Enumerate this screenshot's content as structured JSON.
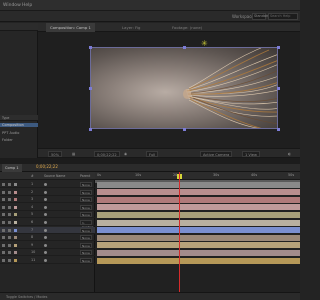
{
  "menubar": {
    "items": [
      "Window",
      "Help"
    ]
  },
  "workspace": {
    "label": "Workspace:",
    "value": "Standard",
    "search_placeholder": "Search Help"
  },
  "project": {
    "items": [
      {
        "label": "Composition",
        "selected": true
      },
      {
        "label": "PPT Audio",
        "selected": false
      },
      {
        "label": "Folder",
        "selected": false
      }
    ],
    "header": "Type"
  },
  "composition_tabs": [
    {
      "label": "Composition: Comp 1",
      "active": true
    },
    {
      "label": "Layer: Fig",
      "active": false
    },
    {
      "label": "Footage: (none)",
      "active": false
    }
  ],
  "viewer_controls": {
    "zoom": "50%",
    "timecode": "0;00;22;22",
    "resolution": "Full",
    "camera": "Active Camera",
    "views": "1 View"
  },
  "timeline": {
    "tab_label": "Comp 1",
    "timecode": "0;00;22;22",
    "columns": [
      "#",
      "Source Name",
      "Parent"
    ],
    "ruler_ticks": [
      "0s",
      "10s",
      "20s",
      "30s",
      "40s",
      "50s"
    ],
    "layers": [
      {
        "num": "1",
        "name": "",
        "parent": "None",
        "color": "#8a8a8a",
        "selected": false
      },
      {
        "num": "2",
        "name": "",
        "parent": "None",
        "color": "#b88e8e",
        "selected": false
      },
      {
        "num": "3",
        "name": "",
        "parent": "None",
        "color": "#b07a7a",
        "selected": false
      },
      {
        "num": "4",
        "name": "",
        "parent": "None",
        "color": "#c09a9a",
        "selected": false
      },
      {
        "num": "5",
        "name": "",
        "parent": "None",
        "color": "#a8a07a",
        "selected": false
      },
      {
        "num": "6",
        "name": "",
        "parent": "1. Control 1",
        "color": "#b8b0a0",
        "selected": false
      },
      {
        "num": "7",
        "name": "",
        "parent": "None",
        "color": "#7a8fd0",
        "selected": true
      },
      {
        "num": "8",
        "name": "",
        "parent": "None",
        "color": "#9a8878",
        "selected": false
      },
      {
        "num": "9",
        "name": "",
        "parent": "None",
        "color": "#b6a27a",
        "selected": false
      },
      {
        "num": "10",
        "name": "",
        "parent": "None",
        "color": "#a38c8c",
        "selected": false
      },
      {
        "num": "11",
        "name": "",
        "parent": "None",
        "color": "#b69858",
        "selected": false
      }
    ]
  },
  "status": {
    "left": "Toggle Switches / Modes"
  },
  "colors": {
    "accent": "#d6d63a",
    "playhead": "#d62b2b",
    "selection": "#3d5a80"
  }
}
